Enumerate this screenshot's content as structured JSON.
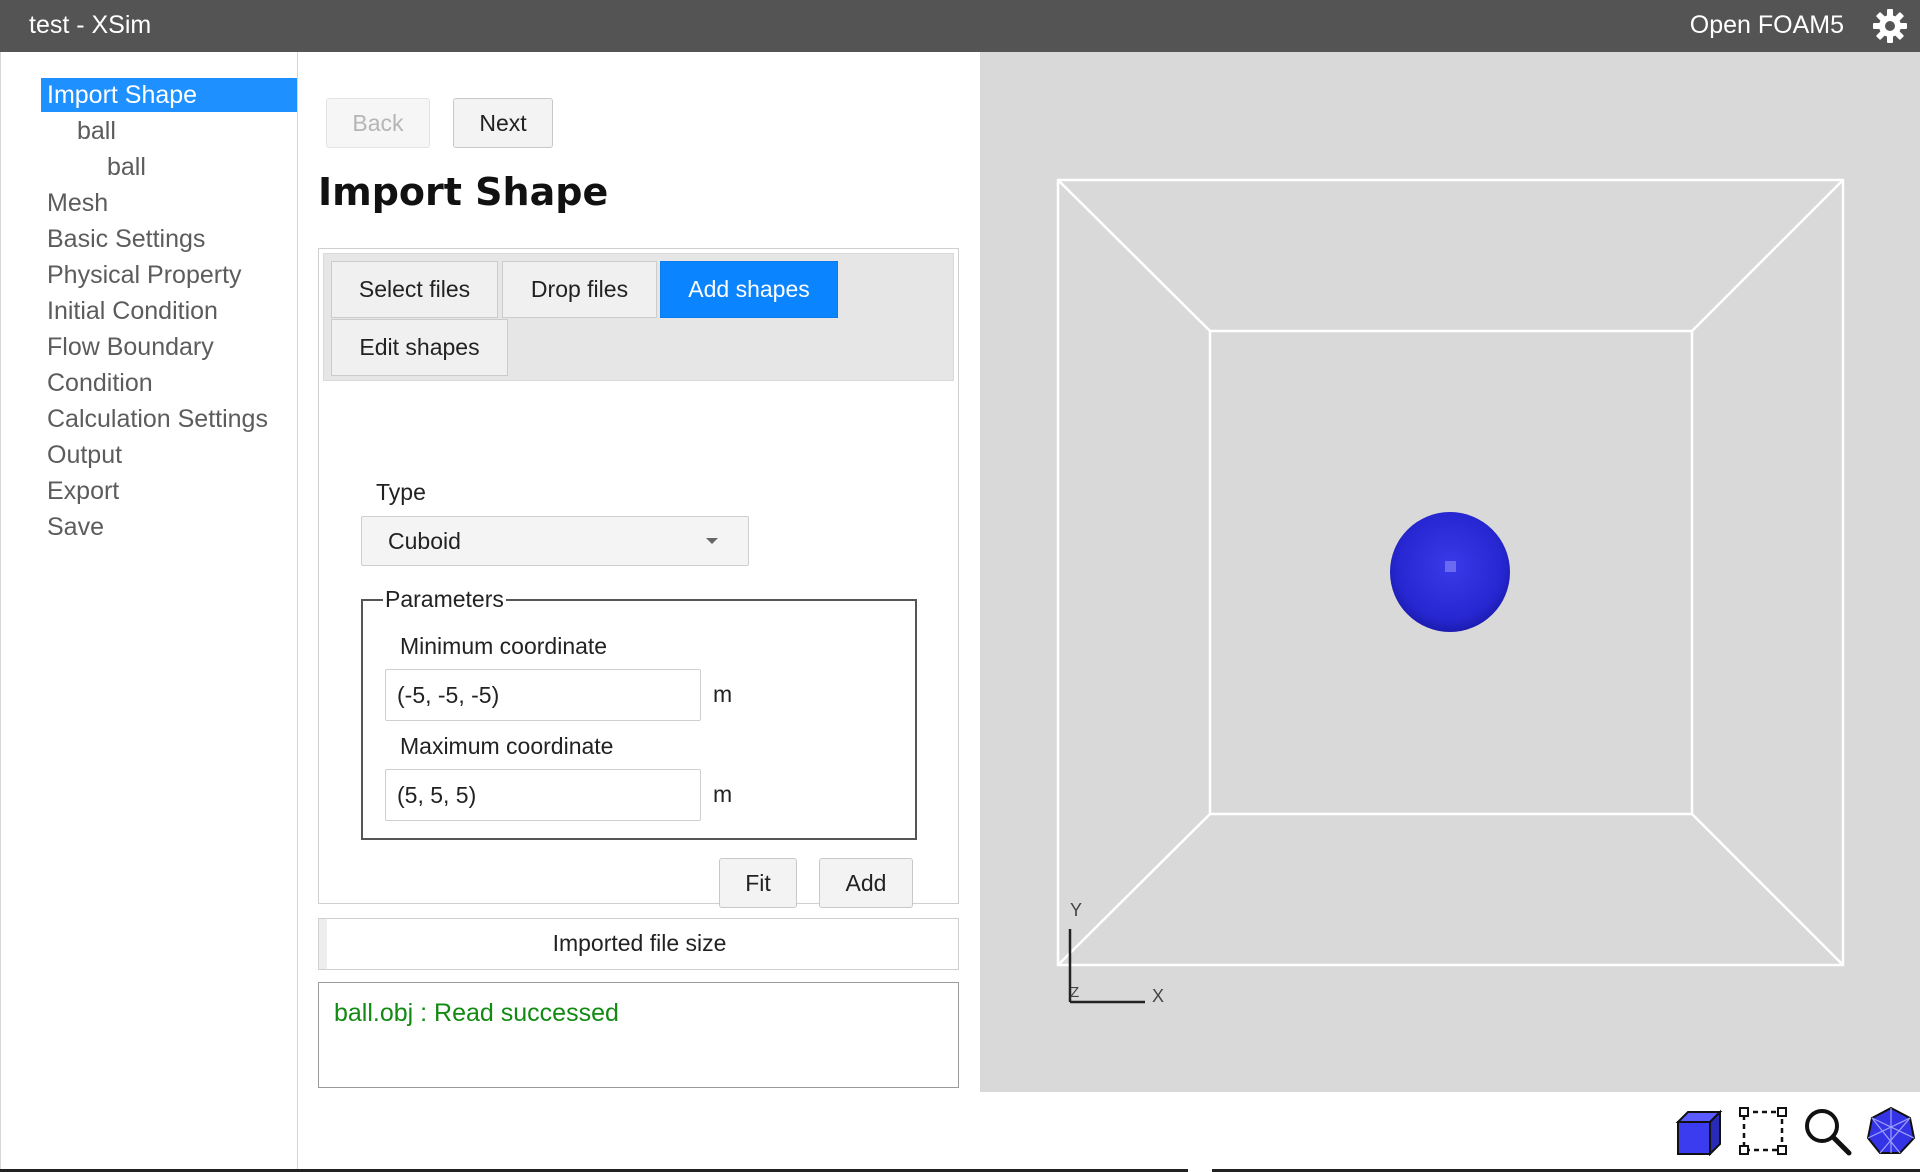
{
  "window": {
    "title": "test - XSim",
    "solver": "Open FOAM5",
    "settings_icon": "gear-icon"
  },
  "nav": {
    "items": [
      {
        "label": "Import Shape",
        "active": true
      },
      {
        "label": "ball",
        "level": 1
      },
      {
        "label": "ball",
        "level": 2
      },
      {
        "label": "Mesh"
      },
      {
        "label": "Basic Settings"
      },
      {
        "label": "Physical Property"
      },
      {
        "label": "Initial Condition"
      },
      {
        "label": "Flow Boundary"
      },
      {
        "label": "Condition"
      },
      {
        "label": "Calculation Settings"
      },
      {
        "label": "Output"
      },
      {
        "label": "Export"
      },
      {
        "label": "Save"
      }
    ]
  },
  "wizard": {
    "back_label": "Back",
    "back_disabled": true,
    "next_label": "Next"
  },
  "page": {
    "title": "Import Shape"
  },
  "tabs": [
    {
      "label": "Select files"
    },
    {
      "label": "Drop files"
    },
    {
      "label": "Add shapes",
      "active": true
    },
    {
      "label": "Edit shapes"
    }
  ],
  "form": {
    "type_label": "Type",
    "type_value": "Cuboid",
    "parameters_legend": "Parameters",
    "min_label": "Minimum coordinate",
    "min_value": "(-5, -5, -5)",
    "min_unit": "m",
    "max_label": "Maximum coordinate",
    "max_value": "(5, 5, 5)",
    "max_unit": "m",
    "fit_label": "Fit",
    "add_label": "Add"
  },
  "filesize": {
    "label": "Imported file size"
  },
  "log": {
    "message": "ball.obj : Read successed",
    "color": "#138a13"
  },
  "viewer": {
    "background": "#d9d9d9",
    "shape_color": "#2b2bd8",
    "axes": {
      "y": "Y",
      "x": "X",
      "z": "Z"
    }
  },
  "toolbar": {
    "tools": [
      "cube-view-icon",
      "select-region-icon",
      "zoom-icon",
      "wireframe-icon"
    ]
  },
  "colors": {
    "accent": "#1e90ff",
    "titlebar": "#545454"
  }
}
